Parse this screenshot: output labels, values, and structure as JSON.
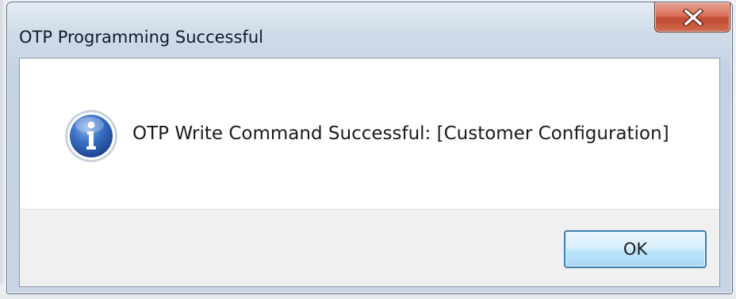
{
  "window": {
    "title": "OTP Programming Successful",
    "close_icon": "close-x-icon"
  },
  "dialog": {
    "icon": "info-icon",
    "message": "OTP Write Command Successful: [Customer Configuration]",
    "ok_label": "OK"
  },
  "colors": {
    "close_button": "#c74a34",
    "ok_border": "#3c7fb1",
    "info_icon": "#2f62b8"
  }
}
